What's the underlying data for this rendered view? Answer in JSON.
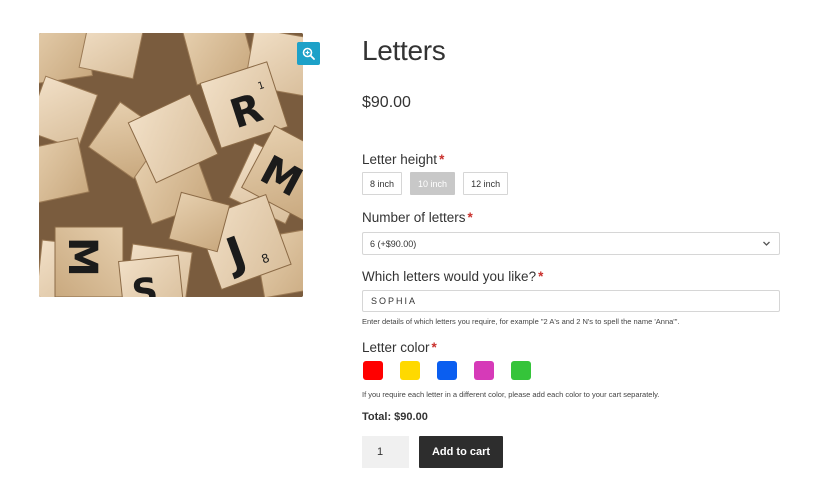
{
  "product": {
    "title": "Letters",
    "price": "$90.00",
    "image_icon": "scrabble-tiles-photo",
    "zoom_icon": "zoom-in-icon"
  },
  "letter_height": {
    "label": "Letter height",
    "required_mark": "*",
    "options": [
      "8 inch",
      "10 inch",
      "12 inch"
    ],
    "selected": "10 inch"
  },
  "number_of_letters": {
    "label": "Number of letters",
    "required_mark": "*",
    "selected_value": "6 (+$90.00)",
    "icon": "chevron-down-icon"
  },
  "which_letters": {
    "label": "Which letters would you like?",
    "required_mark": "*",
    "value": "SOPHIA",
    "help": "Enter details of which letters you require, for example \"2 A's and 2 N's to spell the name 'Anna'\"."
  },
  "letter_color": {
    "label": "Letter color",
    "required_mark": "*",
    "swatches": [
      {
        "name": "red",
        "color": "#ff0000"
      },
      {
        "name": "yellow",
        "color": "#ffd900"
      },
      {
        "name": "blue",
        "color": "#0a5ef0"
      },
      {
        "name": "magenta",
        "color": "#d63ab8"
      },
      {
        "name": "green",
        "color": "#35c43a"
      }
    ],
    "help": "If you require each letter in a different color, please add each color to your cart separately."
  },
  "total": "Total: $90.00",
  "cart": {
    "quantity": "1",
    "add_label": "Add to cart"
  }
}
